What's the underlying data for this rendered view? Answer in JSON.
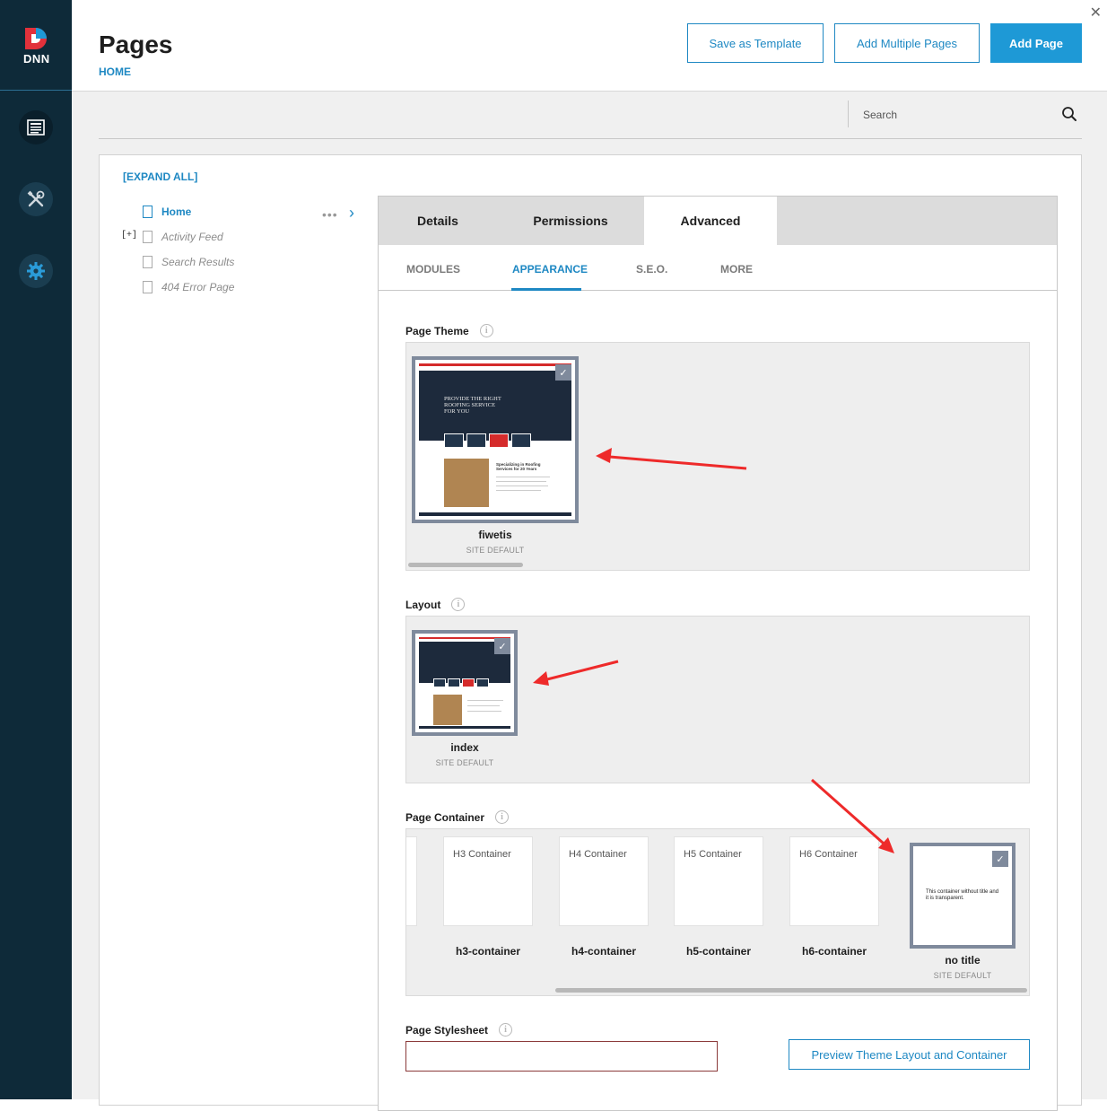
{
  "brand": {
    "logo_text": "DNN",
    "accent": "#1e99d6",
    "sidebar_bg": "#0e2a39"
  },
  "sidebar": {
    "items": [
      {
        "name": "content",
        "icon": "content-pages-icon"
      },
      {
        "name": "manage",
        "icon": "tools-icon"
      },
      {
        "name": "settings",
        "icon": "gear-icon"
      }
    ]
  },
  "header": {
    "title": "Pages",
    "breadcrumb": "HOME",
    "buttons": {
      "save_template": "Save as Template",
      "add_multiple": "Add Multiple Pages",
      "add_page": "Add Page"
    }
  },
  "search": {
    "placeholder": "Search"
  },
  "tree": {
    "expand_all": "[EXPAND ALL]",
    "expander": "[+]",
    "items": [
      "Home",
      "Activity Feed",
      "Search Results",
      "404 Error Page"
    ]
  },
  "tabs": [
    "Details",
    "Permissions",
    "Advanced"
  ],
  "active_tab": "Advanced",
  "subtabs": [
    "MODULES",
    "APPEARANCE",
    "S.E.O.",
    "MORE"
  ],
  "active_subtab": "APPEARANCE",
  "page_theme": {
    "label": "Page Theme",
    "items": [
      {
        "name": "fiwetis",
        "note": "SITE DEFAULT",
        "selected": true
      }
    ],
    "preview_text": "PROVIDE THE RIGHT ROOFING SERVICE FOR YOU",
    "preview_subtext": "Specializing in Roofing Services for 20 Years"
  },
  "layout": {
    "label": "Layout",
    "items": [
      {
        "name": "index",
        "note": "SITE DEFAULT",
        "selected": true
      }
    ]
  },
  "page_container": {
    "label": "Page Container",
    "items": [
      {
        "title": "H3 Container",
        "name": "h3-container"
      },
      {
        "title": "H4 Container",
        "name": "h4-container"
      },
      {
        "title": "H5 Container",
        "name": "h5-container"
      },
      {
        "title": "H6 Container",
        "name": "h6-container"
      },
      {
        "title": "This container without title and it is transparent.",
        "name": "no title",
        "note": "SITE DEFAULT",
        "selected": true
      }
    ]
  },
  "page_stylesheet": {
    "label": "Page Stylesheet",
    "value": ""
  },
  "preview_button": "Preview Theme Layout and Container",
  "info_glyph": "i",
  "check_glyph": "✓"
}
